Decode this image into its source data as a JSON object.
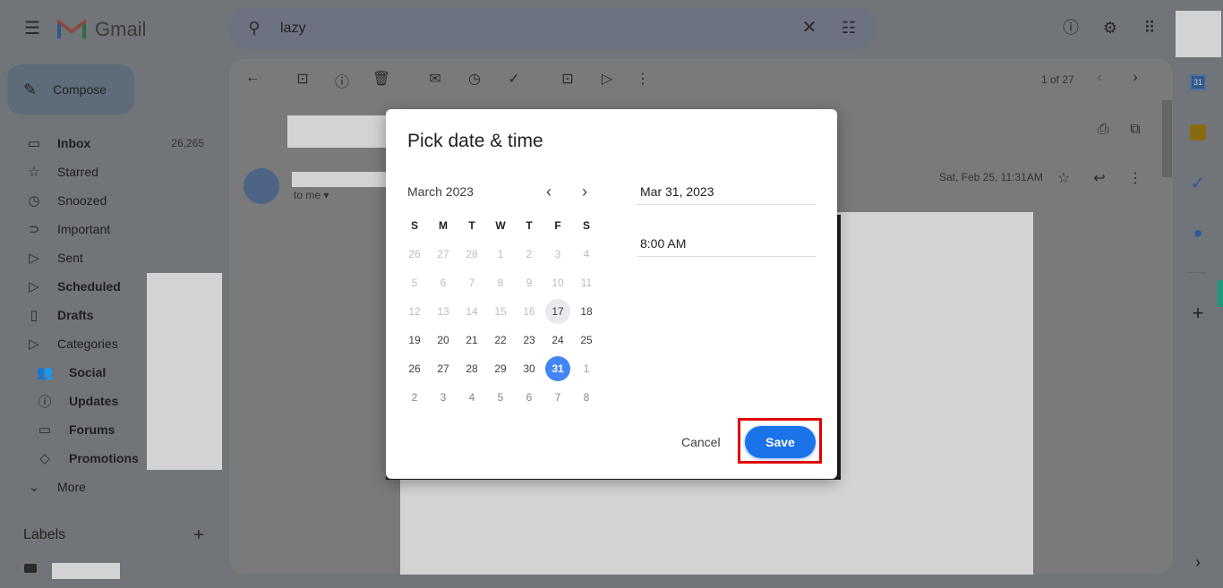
{
  "header": {
    "app_name": "Gmail",
    "search_value": "lazy"
  },
  "sidebar": {
    "compose": "Compose",
    "items": [
      {
        "label": "Inbox",
        "count": "26,265",
        "icon": "inbox-icon",
        "glyph": "▭",
        "bold": true
      },
      {
        "label": "Starred",
        "icon": "star-icon",
        "glyph": "☆"
      },
      {
        "label": "Snoozed",
        "icon": "clock-icon",
        "glyph": "◷"
      },
      {
        "label": "Important",
        "icon": "important-icon",
        "glyph": "⊃"
      },
      {
        "label": "Sent",
        "icon": "send-icon",
        "glyph": "▷"
      },
      {
        "label": "Scheduled",
        "icon": "scheduled-icon",
        "glyph": "▷",
        "bold": true
      },
      {
        "label": "Drafts",
        "icon": "draft-icon",
        "glyph": "▯",
        "bold": true
      },
      {
        "label": "Categories",
        "icon": "label-icon",
        "glyph": "▷"
      },
      {
        "label": "Social",
        "icon": "people-icon",
        "glyph": "👥",
        "sub": true
      },
      {
        "label": "Updates",
        "icon": "info-icon",
        "glyph": "ⓘ",
        "sub": true
      },
      {
        "label": "Forums",
        "icon": "forum-icon",
        "glyph": "▭",
        "sub": true
      },
      {
        "label": "Promotions",
        "icon": "tag-icon",
        "glyph": "◇",
        "sub": true
      },
      {
        "label": "More",
        "icon": "chevron-down-icon",
        "glyph": "⌄"
      }
    ],
    "labels_heading": "Labels"
  },
  "toolbar": {
    "pagination": "1 of 27"
  },
  "message": {
    "recipient": "to me",
    "date": "Sat, Feb 25, 11:31AM"
  },
  "dialog": {
    "title": "Pick date & time",
    "month": "March 2023",
    "weekdays": [
      "S",
      "M",
      "T",
      "W",
      "T",
      "F",
      "S"
    ],
    "days": [
      [
        "26",
        "27",
        "28",
        "1",
        "2",
        "3",
        "4"
      ],
      [
        "5",
        "6",
        "7",
        "8",
        "9",
        "10",
        "11"
      ],
      [
        "12",
        "13",
        "14",
        "15",
        "16",
        "17",
        "18"
      ],
      [
        "19",
        "20",
        "21",
        "22",
        "23",
        "24",
        "25"
      ],
      [
        "26",
        "27",
        "28",
        "29",
        "30",
        "31",
        "1"
      ],
      [
        "2",
        "3",
        "4",
        "5",
        "6",
        "7",
        "8"
      ]
    ],
    "today": "17",
    "selected": "31",
    "date_value": "Mar 31, 2023",
    "time_value": "8:00 AM",
    "cancel": "Cancel",
    "save": "Save"
  },
  "colors": {
    "accent": "#1a73e8",
    "selected_day": "#4285f4",
    "highlight_box": "#e00000"
  }
}
